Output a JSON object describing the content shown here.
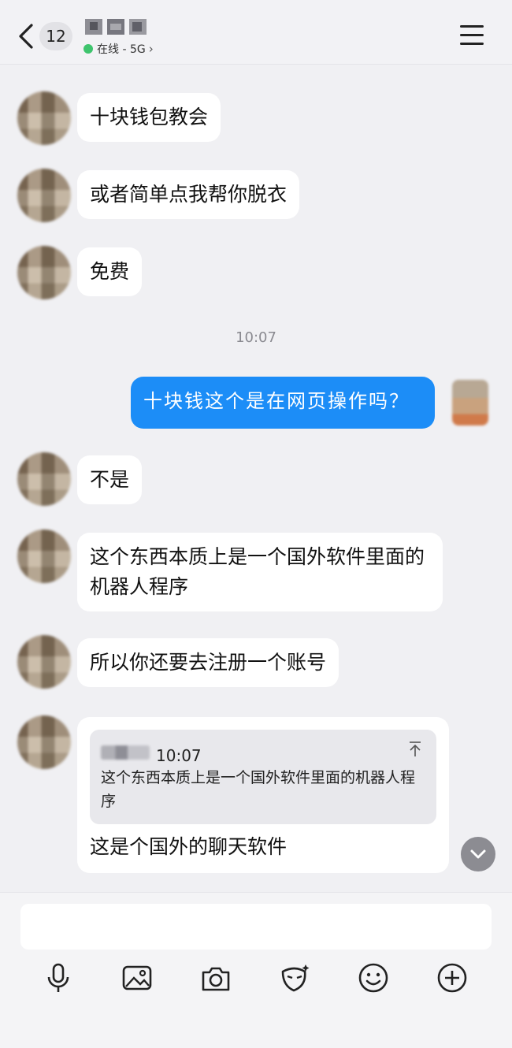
{
  "header": {
    "back_count": "12",
    "status_text": "在线 - 5G",
    "status_color": "#3ec46d"
  },
  "messages": [
    {
      "side": "left",
      "text": "十块钱包教会"
    },
    {
      "side": "left",
      "text": "或者简单点我帮你脱衣"
    },
    {
      "side": "left",
      "text": "免费"
    },
    {
      "side": "time",
      "text": "10:07"
    },
    {
      "side": "right",
      "text": "十块钱这个是在网页操作吗？"
    },
    {
      "side": "left",
      "text": "不是"
    },
    {
      "side": "left",
      "text": "这个东西本质上是一个国外软件里面的机器人程序"
    },
    {
      "side": "left",
      "text": "所以你还要去注册一个账号"
    },
    {
      "side": "left",
      "quote": {
        "time": "10:07",
        "text": "这个东西本质上是一个国外软件里面的机器人程序"
      },
      "text": "这是个国外的聊天软件"
    }
  ],
  "toolbar": {
    "icons": [
      "microphone-icon",
      "image-icon",
      "camera-icon",
      "mask-icon",
      "emoji-icon",
      "plus-icon"
    ]
  },
  "colors": {
    "my_bubble": "#1c8df7",
    "their_bubble": "#ffffff",
    "background": "#f0f0f3"
  }
}
